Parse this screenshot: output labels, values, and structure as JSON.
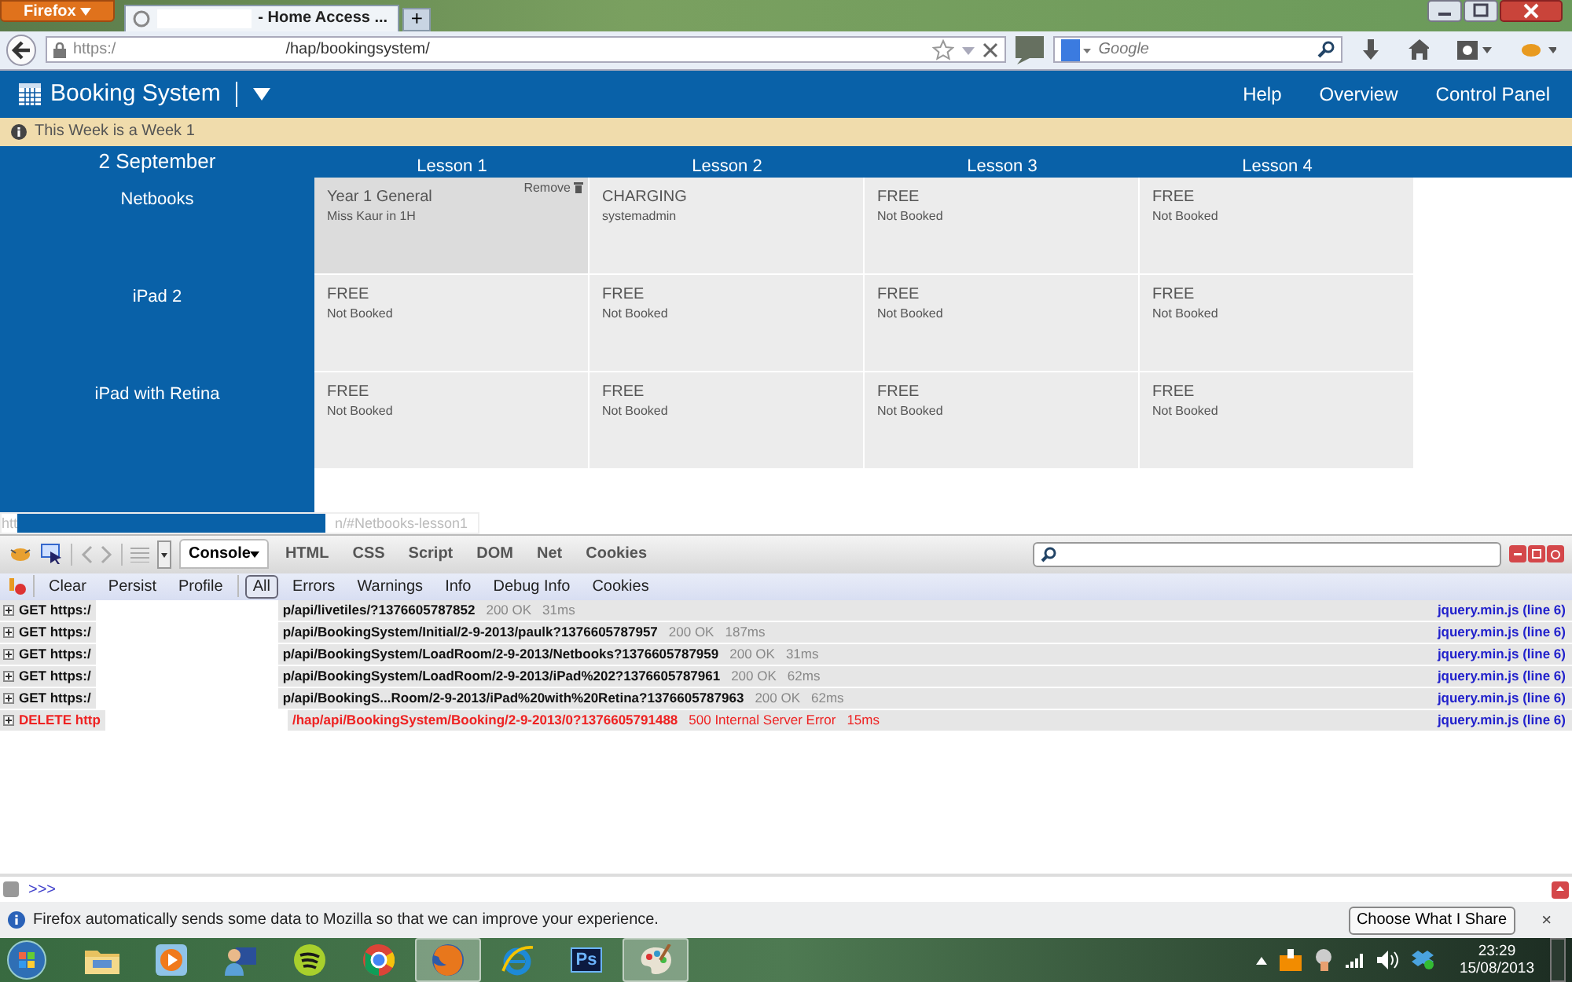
{
  "browser": {
    "menu_button": "Firefox",
    "tabs": [
      {
        "title": "- Home Access ...",
        "selected": true
      }
    ],
    "new_tab": "+",
    "url_scheme": "https:/",
    "url_path": "/hap/bookingsystem/",
    "search_placeholder": "Google"
  },
  "app": {
    "title": "Booking System",
    "nav": [
      "Help",
      "Overview",
      "Control Panel"
    ],
    "notice": "This Week is a Week 1",
    "date": "2 September",
    "lessons": [
      "Lesson 1",
      "Lesson 2",
      "Lesson 3",
      "Lesson 4"
    ],
    "resources": [
      {
        "name": "Netbooks",
        "slots": [
          {
            "title": "Year 1 General",
            "detail": "Miss Kaur in 1H",
            "booked": true,
            "action": "Remove"
          },
          {
            "title": "CHARGING",
            "detail": "systemadmin",
            "booked": false
          },
          {
            "title": "FREE",
            "detail": "Not Booked",
            "booked": false
          },
          {
            "title": "FREE",
            "detail": "Not Booked",
            "booked": false
          }
        ]
      },
      {
        "name": "iPad 2",
        "slots": [
          {
            "title": "FREE",
            "detail": "Not Booked",
            "booked": false
          },
          {
            "title": "FREE",
            "detail": "Not Booked",
            "booked": false
          },
          {
            "title": "FREE",
            "detail": "Not Booked",
            "booked": false
          },
          {
            "title": "FREE",
            "detail": "Not Booked",
            "booked": false
          }
        ]
      },
      {
        "name": "iPad with Retina",
        "slots": [
          {
            "title": "FREE",
            "detail": "Not Booked",
            "booked": false
          },
          {
            "title": "FREE",
            "detail": "Not Booked",
            "booked": false
          },
          {
            "title": "FREE",
            "detail": "Not Booked",
            "booked": false
          },
          {
            "title": "FREE",
            "detail": "Not Booked",
            "booked": false
          }
        ]
      }
    ]
  },
  "status_bar": {
    "start": "htt",
    "link": "n/#Netbooks-lesson1"
  },
  "devtools": {
    "panels": [
      {
        "label": "Console",
        "selected": true
      },
      {
        "label": "HTML",
        "selected": false
      },
      {
        "label": "CSS",
        "selected": false
      },
      {
        "label": "Script",
        "selected": false
      },
      {
        "label": "DOM",
        "selected": false
      },
      {
        "label": "Net",
        "selected": false
      },
      {
        "label": "Cookies",
        "selected": false
      }
    ],
    "actions": [
      "Clear",
      "Persist",
      "Profile"
    ],
    "filters": [
      {
        "label": "All",
        "selected": true
      },
      {
        "label": "Errors",
        "selected": false
      },
      {
        "label": "Warnings",
        "selected": false
      },
      {
        "label": "Info",
        "selected": false
      },
      {
        "label": "Debug Info",
        "selected": false
      },
      {
        "label": "Cookies",
        "selected": false
      }
    ],
    "log": [
      {
        "method": "GET",
        "url_start": "https:/",
        "url_end": "p/api/livetiles/?1376605787852",
        "status": "200 OK",
        "time": "31ms",
        "source": "jquery.min.js (line 6)",
        "error": false
      },
      {
        "method": "GET",
        "url_start": "https:/",
        "url_end": "p/api/BookingSystem/Initial/2-9-2013/paulk?1376605787957",
        "status": "200 OK",
        "time": "187ms",
        "source": "jquery.min.js (line 6)",
        "error": false
      },
      {
        "method": "GET",
        "url_start": "https:/",
        "url_end": "p/api/BookingSystem/LoadRoom/2-9-2013/Netbooks?1376605787959",
        "status": "200 OK",
        "time": "31ms",
        "source": "jquery.min.js (line 6)",
        "error": false
      },
      {
        "method": "GET",
        "url_start": "https:/",
        "url_end": "p/api/BookingSystem/LoadRoom/2-9-2013/iPad%202?1376605787961",
        "status": "200 OK",
        "time": "62ms",
        "source": "jquery.min.js (line 6)",
        "error": false
      },
      {
        "method": "GET",
        "url_start": "https:/",
        "url_end": "p/api/BookingS...Room/2-9-2013/iPad%20with%20Retina?1376605787963",
        "status": "200 OK",
        "time": "62ms",
        "source": "jquery.min.js (line 6)",
        "error": false
      },
      {
        "method": "DELETE",
        "url_start": "http",
        "url_end": "/hap/api/BookingSystem/Booking/2-9-2013/0?1376605791488",
        "status": "500 Internal Server Error",
        "time": "15ms",
        "source": "jquery.min.js (line 6)",
        "error": true
      }
    ],
    "prompt": ">>>"
  },
  "notification": {
    "message": "Firefox automatically sends some data to Mozilla so that we can improve your experience.",
    "button": "Choose What I Share",
    "close": "×"
  },
  "taskbar": {
    "apps": [
      {
        "kind": "folder",
        "selected": false
      },
      {
        "kind": "player",
        "selected": false
      },
      {
        "kind": "person",
        "selected": false
      },
      {
        "kind": "waves",
        "selected": false
      },
      {
        "kind": "ring",
        "selected": false
      },
      {
        "kind": "fox",
        "selected": true
      },
      {
        "kind": "browser",
        "selected": false
      },
      {
        "kind": "ps",
        "label": "Ps",
        "selected": false
      },
      {
        "kind": "palette",
        "selected": true
      }
    ],
    "time": "23:29",
    "date": "15/08/2013"
  }
}
